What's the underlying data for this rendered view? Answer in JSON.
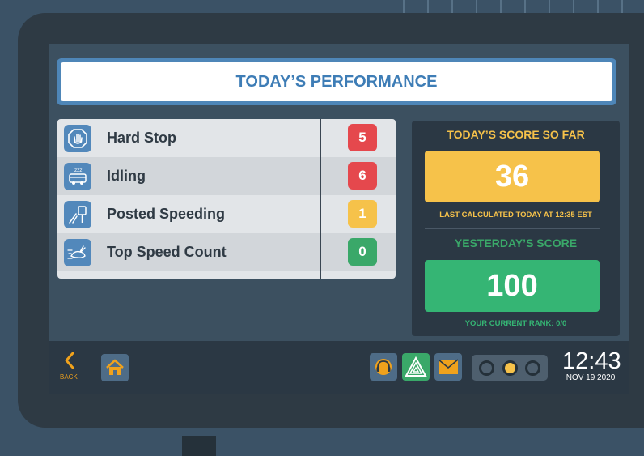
{
  "header": {
    "title": "TODAY’S PERFORMANCE"
  },
  "metrics": [
    {
      "label": "Hard Stop",
      "count": "5",
      "icon": "hand-stop-icon",
      "color": "#e5484d"
    },
    {
      "label": "Idling",
      "count": "6",
      "icon": "idling-vehicle-icon",
      "color": "#e5484d"
    },
    {
      "label": "Posted Speeding",
      "count": "1",
      "icon": "speed-sign-icon",
      "color": "#f6c24a"
    },
    {
      "label": "Top Speed Count",
      "count": "0",
      "icon": "speeding-rabbit-icon",
      "color": "#3aa869"
    }
  ],
  "score": {
    "today_heading": "TODAY’S SCORE SO FAR",
    "today_value": "36",
    "today_color": "#f6c24a",
    "last_calculated": "LAST CALCULATED TODAY AT 12:35 EST",
    "yesterday_heading": "YESTERDAY’S SCORE",
    "yesterday_value": "100",
    "yesterday_color": "#35b574",
    "rank_text": "YOUR CURRENT RANK:  0/0"
  },
  "footer": {
    "back_label": "BACK",
    "time": "12:43",
    "date": "NOV 19 2020",
    "buttons": [
      "headset-icon",
      "hazard-triangle-icon",
      "mail-icon"
    ],
    "status_lights": [
      "gray",
      "yellow",
      "gray"
    ]
  },
  "colors": {
    "accent": "#f0a21c",
    "header_blue": "#3e7db6"
  }
}
